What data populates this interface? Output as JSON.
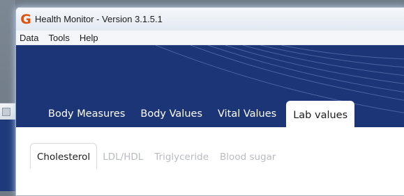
{
  "window": {
    "title": "Health Monitor - Version 3.1.5.1",
    "app_icon_glyph": "G",
    "app_icon_name": "app-logo-icon",
    "app_icon_color": "#e2520b"
  },
  "menu": {
    "items": [
      {
        "label": "Data"
      },
      {
        "label": "Tools"
      },
      {
        "label": "Help"
      }
    ]
  },
  "banner": {
    "background_color": "#1c3577",
    "tabs": [
      {
        "label": "Body Measures",
        "active": false
      },
      {
        "label": "Body Values",
        "active": false
      },
      {
        "label": "Vital Values",
        "active": false
      },
      {
        "label": "Lab values",
        "active": true
      }
    ]
  },
  "content": {
    "subtabs": [
      {
        "label": "Cholesterol",
        "active": true
      },
      {
        "label": "LDL/HDL",
        "active": false
      },
      {
        "label": "Triglyceride",
        "active": false
      },
      {
        "label": "Blood sugar",
        "active": false
      }
    ]
  }
}
